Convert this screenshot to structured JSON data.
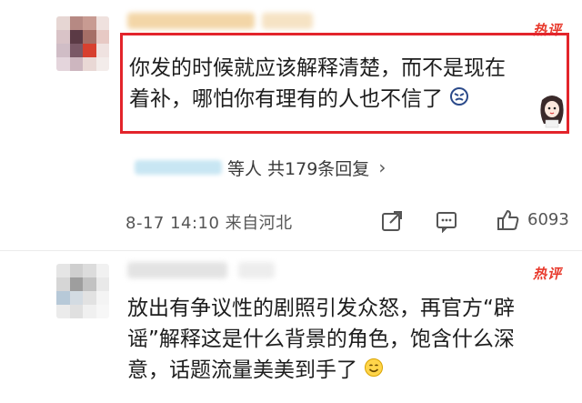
{
  "comment1": {
    "badge": "热评",
    "text_line1": "你发的时候就应该解释清楚，而不是现在",
    "text_line2": "着补，哪怕你有理有的人也不信了",
    "reply_summary": "等人 共179条回复",
    "reply_chevron": "›",
    "date": "8-17 14:10 来自河北",
    "like_count": "6093",
    "highlight_color": "#e3242b"
  },
  "comment2": {
    "badge": "热评",
    "text_line1": "放出有争议性的剧照引发众怒，再官方“辟",
    "text_line2": "谣”解释这是什么背景的角色，饱含什么深",
    "text_line3": "意，话题流量美美到手了"
  },
  "icons": {
    "share": "share-icon",
    "comment": "comment-icon",
    "like": "thumbs-up-icon"
  }
}
